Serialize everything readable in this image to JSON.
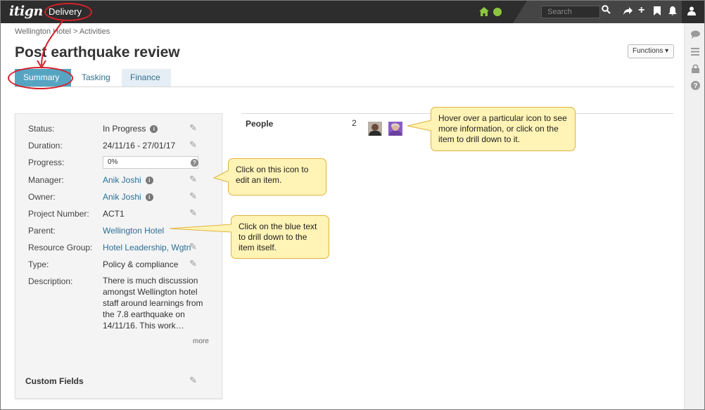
{
  "app": {
    "logo_prefix": "i",
    "logo_name": "tign",
    "module": "Delivery"
  },
  "topbar": {
    "search_placeholder": "Search"
  },
  "breadcrumb": "Wellington Hotel > Activities",
  "page_title": "Post earthquake review",
  "functions_label": "Functions ▾",
  "tabs": [
    {
      "label": "Summary"
    },
    {
      "label": "Tasking"
    },
    {
      "label": "Finance"
    }
  ],
  "fields": {
    "status": {
      "label": "Status:",
      "value": "In Progress"
    },
    "duration": {
      "label": "Duration:",
      "value": "24/11/16 - 27/01/17"
    },
    "progress": {
      "label": "Progress:",
      "value": "0%"
    },
    "manager": {
      "label": "Manager:",
      "value": "Anik Joshi"
    },
    "owner": {
      "label": "Owner:",
      "value": "Anik Joshi"
    },
    "project_number": {
      "label": "Project Number:",
      "value": "ACT1"
    },
    "parent": {
      "label": "Parent:",
      "value": "Wellington Hotel"
    },
    "resource_group": {
      "label": "Resource Group:",
      "value": "Hotel Leadership, Wgtn"
    },
    "type": {
      "label": "Type:",
      "value": "Policy & compliance"
    },
    "description": {
      "label": "Description:",
      "value": "There is much discussion amongst Wellington hotel staff around learnings from the 7.8 earthquake on 14/11/16.  This work…"
    }
  },
  "more_label": "more",
  "custom_fields_label": "Custom Fields",
  "people": {
    "label": "People",
    "count": "2"
  },
  "callouts": {
    "hover_tip": "Hover over a particular icon to see more information, or click on the item to drill down to it.",
    "edit_tip": "Click on this icon to edit an item.",
    "drill_tip": "Click on the blue text to drill down to the item itself."
  },
  "colors": {
    "topbar": "#2d2d2d",
    "accent_green": "#8cc63f",
    "tab_active": "#55a4c2",
    "link": "#2a6f95",
    "callout": "#fff3b5",
    "annotation_red": "#d6202a"
  },
  "icons": [
    "home-icon",
    "globe-icon",
    "search-icon",
    "share-icon",
    "plus-icon",
    "bookmark-icon",
    "bell-icon",
    "user-icon",
    "comment-icon",
    "list-icon",
    "lock-icon",
    "help-icon",
    "pencil-icon",
    "info-icon"
  ]
}
